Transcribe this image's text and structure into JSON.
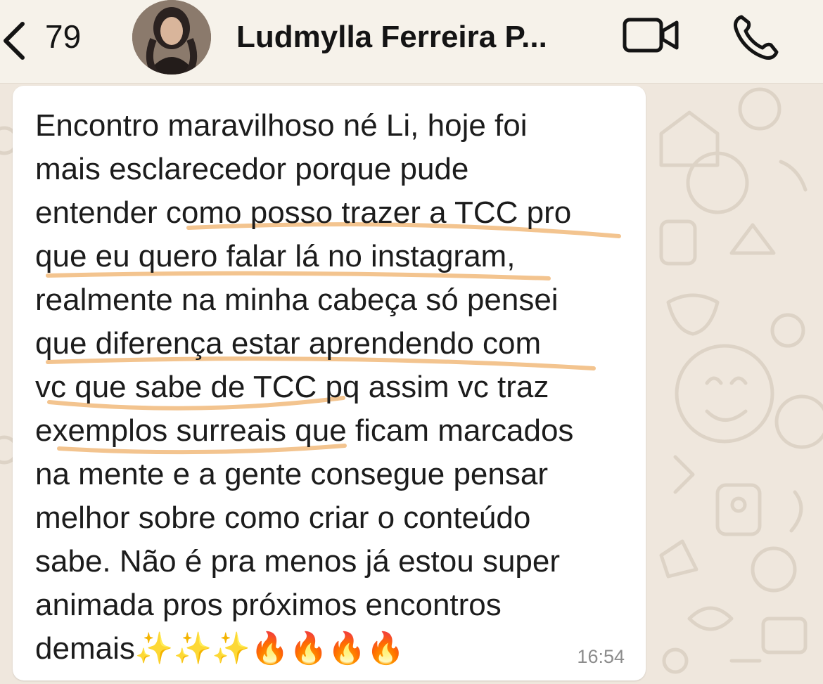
{
  "header": {
    "back_count": "79",
    "contact_name": "Ludmylla Ferreira P..."
  },
  "icons": {
    "back": "chevron-left-icon",
    "video": "video-camera-icon",
    "call": "phone-icon"
  },
  "message": {
    "lines": [
      "Encontro maravilhoso né Li, hoje foi",
      "mais esclarecedor porque pude",
      "entender como posso trazer a TCC pro",
      "que eu quero falar lá no instagram,",
      "realmente na minha cabeça só pensei",
      "que diferença estar aprendendo com",
      "vc que sabe de TCC pq assim vc traz",
      "exemplos surreais que ficam marcados",
      "na mente e a gente consegue pensar",
      "melhor sobre como criar o conteúdo",
      "sabe. Não é pra menos já estou super",
      "animada pros próximos encontros",
      "demais✨✨✨🔥🔥🔥🔥"
    ],
    "time": "16:54"
  },
  "colors": {
    "wallpaper": "#efe7dd",
    "header": "#f6f2ea",
    "bubble": "#ffffff",
    "highlight": "#f3c48f",
    "timestamp": "#8c8c8c"
  }
}
